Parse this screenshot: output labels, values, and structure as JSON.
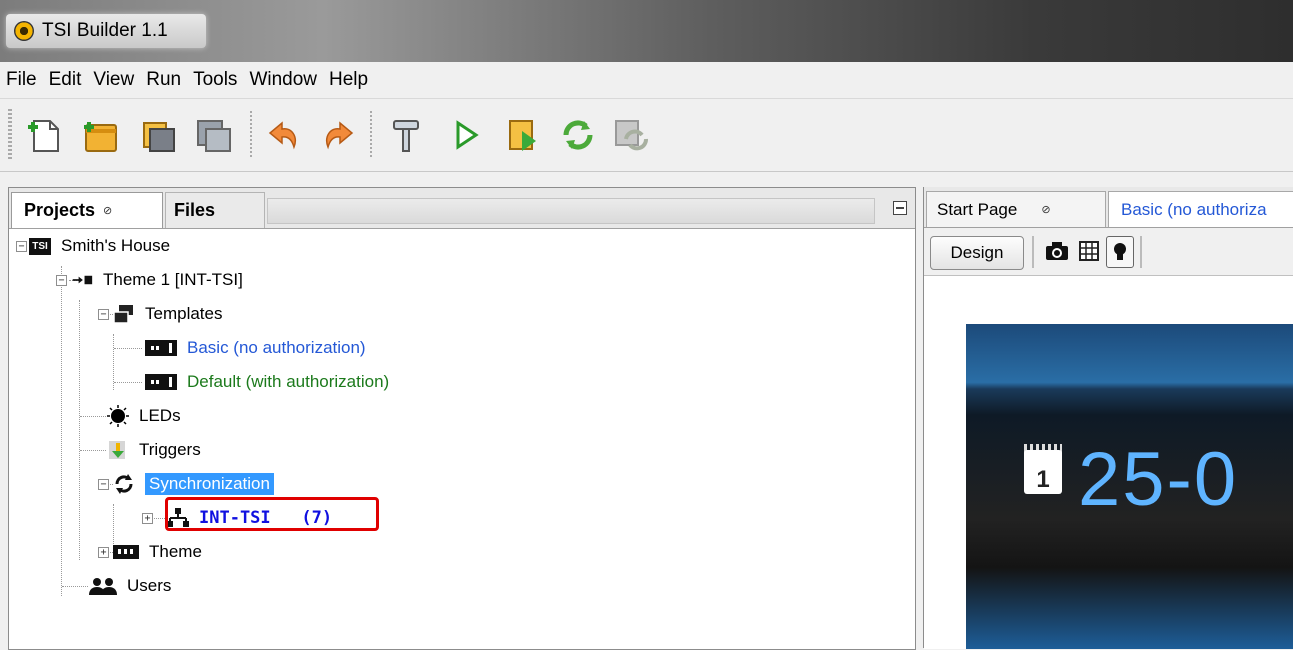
{
  "window": {
    "title": "TSI Builder 1.1"
  },
  "menu": [
    "File",
    "Edit",
    "View",
    "Run",
    "Tools",
    "Window",
    "Help"
  ],
  "toolbar": {
    "buttons": [
      "new-file-icon",
      "new-project-icon",
      "open-project-icon",
      "save-all-icon",
      "undo-icon",
      "redo-icon",
      "build-hammer-icon",
      "run-icon",
      "run-file-icon",
      "synchronize-icon",
      "synchronize-disabled-icon"
    ]
  },
  "projects_panel": {
    "tabs": [
      {
        "label": "Projects",
        "close": "⊘"
      },
      {
        "label": "Files"
      }
    ],
    "tree": {
      "root": "Smith's House",
      "root_badge": "TSI",
      "theme_node": "Theme 1 [INT-TSI]",
      "templates": "Templates",
      "template_basic": "Basic (no authorization)",
      "template_default": "Default (with authorization)",
      "leds": "LEDs",
      "triggers": "Triggers",
      "synchronization": "Synchronization",
      "int_tsi": "INT-TSI   (7)",
      "theme": "Theme",
      "users": "Users"
    }
  },
  "editor": {
    "tabs": [
      {
        "label": "Start Page",
        "close": "⊘"
      },
      {
        "label": "Basic (no authoriza"
      }
    ],
    "design_button": "Design",
    "preview": {
      "date": "25-0",
      "calendar_day": "1"
    }
  },
  "colors": {
    "link_blue": "#2458d6",
    "green": "#1c7a1c",
    "selection": "#3399ff",
    "highlight_red": "#e00000"
  }
}
